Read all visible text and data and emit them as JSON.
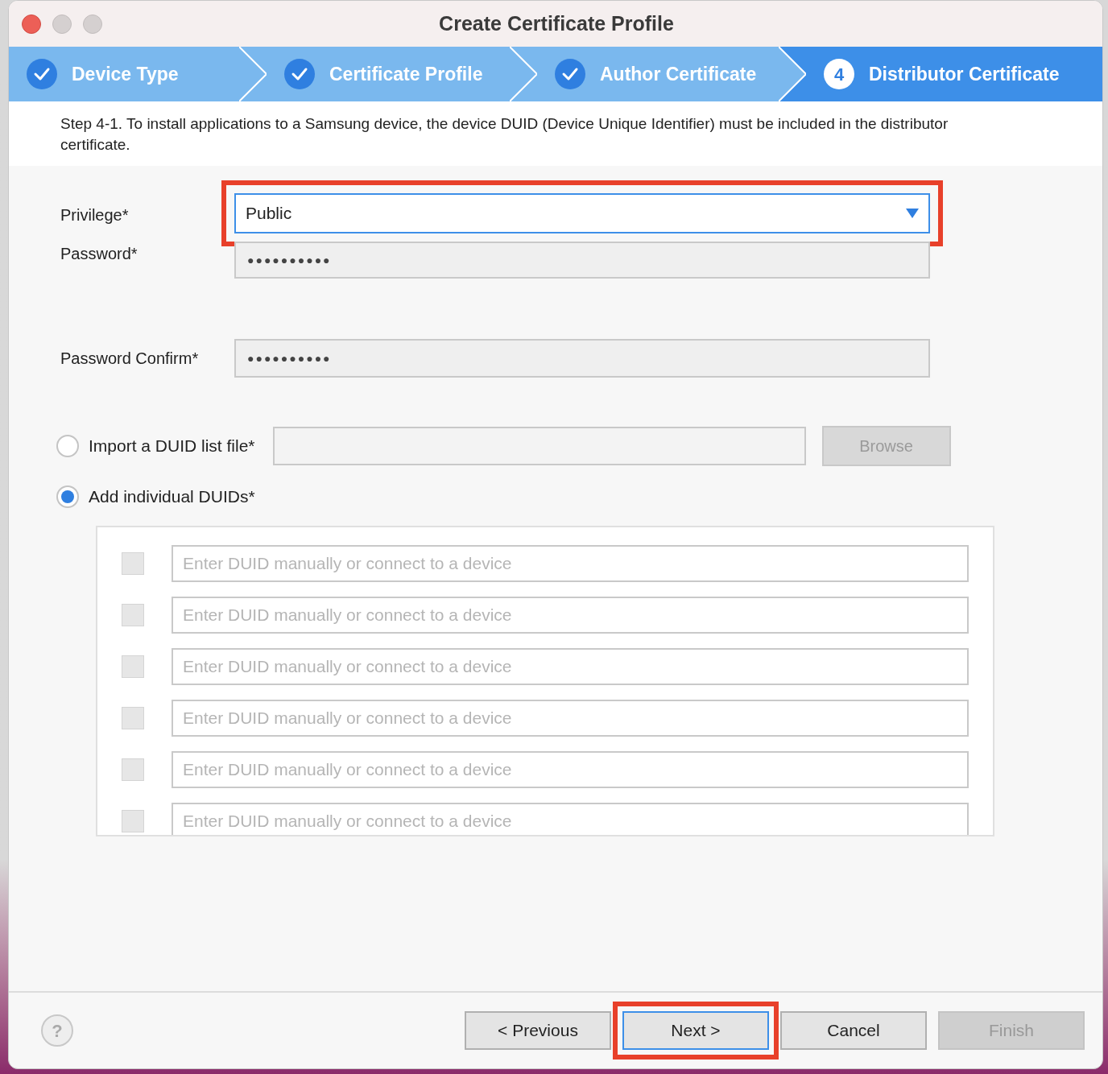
{
  "window": {
    "title": "Create Certificate Profile"
  },
  "steps": [
    {
      "label": "Device Type",
      "completed": true,
      "selected": false
    },
    {
      "label": "Certificate Profile",
      "completed": true,
      "selected": false
    },
    {
      "label": "Author Certificate",
      "completed": true,
      "selected": false
    },
    {
      "label": "Distributor Certificate",
      "completed": false,
      "selected": true,
      "number": "4"
    }
  ],
  "description": "Step 4-1. To install applications to a Samsung device, the device DUID (Device Unique Identifier) must be included in the distributor certificate.",
  "privilege": {
    "label": "Privilege*",
    "value": "Public",
    "highlighted": true
  },
  "password": {
    "label": "Password*",
    "value": "●●●●●●●●●●"
  },
  "password_confirm": {
    "label": "Password Confirm*",
    "value": "●●●●●●●●●●"
  },
  "duid_source": [
    {
      "label": "Import a DUID list file*",
      "selected": false,
      "kind": "file"
    },
    {
      "label": "Add individual DUIDs*",
      "selected": true,
      "kind": "list"
    }
  ],
  "browse_button": {
    "label": "Browse",
    "disabled": true
  },
  "duids": [
    {
      "placeholder": "Enter DUID manually or connect to a device",
      "checked": false
    },
    {
      "placeholder": "Enter DUID manually or connect to a device",
      "checked": false
    },
    {
      "placeholder": "Enter DUID manually or connect to a device",
      "checked": false
    },
    {
      "placeholder": "Enter DUID manually or connect to a device",
      "checked": false
    },
    {
      "placeholder": "Enter DUID manually or connect to a device",
      "checked": false
    },
    {
      "placeholder": "Enter DUID manually or connect to a device",
      "checked": false
    }
  ],
  "help": "?",
  "buttons": [
    {
      "label": "< Previous",
      "disabled": false,
      "default": false,
      "highlighted": false
    },
    {
      "label": "Next >",
      "disabled": false,
      "default": true,
      "highlighted": true
    },
    {
      "label": "Cancel",
      "disabled": false,
      "default": false,
      "highlighted": false
    },
    {
      "label": "Finish",
      "disabled": true,
      "default": false,
      "highlighted": false
    }
  ]
}
